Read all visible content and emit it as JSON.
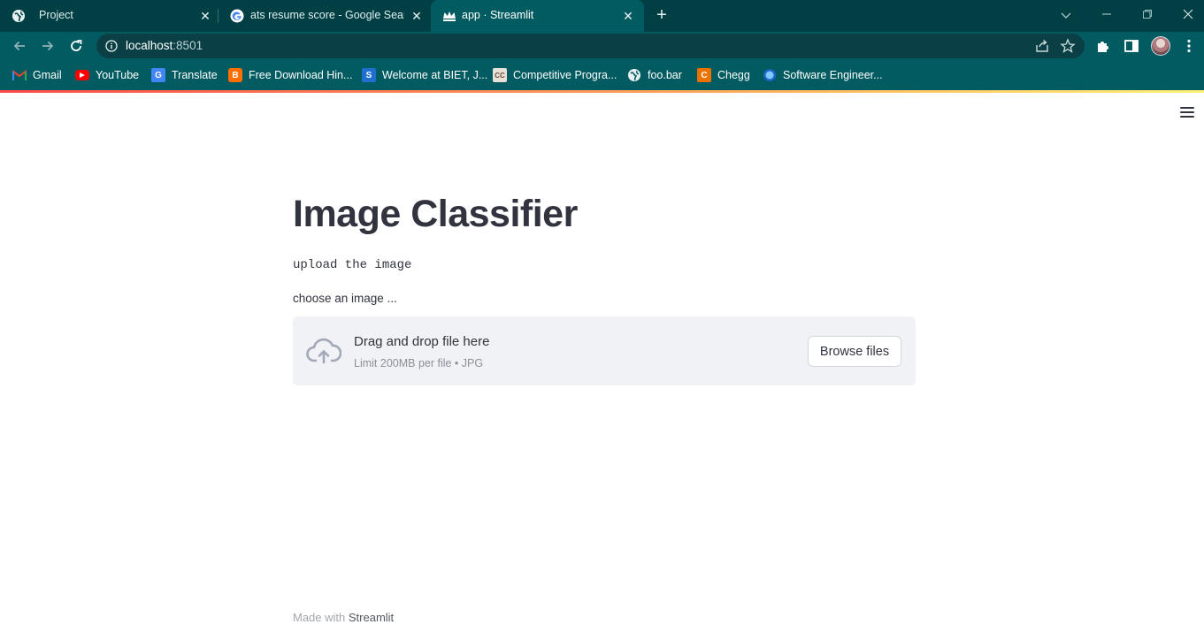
{
  "browser": {
    "tabs": [
      {
        "title": "Project",
        "icon": "globe-icon",
        "active": false
      },
      {
        "title": "ats resume score - Google Search",
        "icon": "google-icon",
        "active": false
      },
      {
        "title": "app · Streamlit",
        "icon": "streamlit-crown-icon",
        "active": true
      }
    ],
    "url_host": "localhost",
    "url_port": ":8501",
    "bookmarks": [
      {
        "label": "Gmail",
        "icon": "gmail-icon",
        "color": "#ea4335"
      },
      {
        "label": "YouTube",
        "icon": "youtube-icon",
        "color": "#ff0000"
      },
      {
        "label": "Translate",
        "icon": "translate-icon",
        "color": "#4285f4"
      },
      {
        "label": "Free Download Hin...",
        "icon": "blogger-icon",
        "color": "#ff6f00"
      },
      {
        "label": "Welcome at BIET, J...",
        "icon": "s-icon",
        "color": "#1f6fd1"
      },
      {
        "label": "Competitive Progra...",
        "icon": "cc-icon",
        "color": "#6b4a3a"
      },
      {
        "label": "foo.bar",
        "icon": "globe-icon",
        "color": "#ffffff"
      },
      {
        "label": "Chegg",
        "icon": "chegg-icon",
        "color": "#eb7100"
      },
      {
        "label": "Software Engineer...",
        "icon": "circle-icon",
        "color": "#3aa0ff"
      }
    ]
  },
  "app": {
    "title": "Image Classifier",
    "subtitle": "upload the image",
    "uploader_label": "choose an image ...",
    "dropzone_title": "Drag and drop file here",
    "dropzone_limit": "Limit 200MB per file • JPG",
    "browse_label": "Browse files",
    "footer_prefix": "Made with ",
    "footer_brand": "Streamlit"
  },
  "colors": {
    "tabbar_bg": "#003f44",
    "toolbar_bg": "#015b61",
    "text_primary": "#31333f",
    "dropzone_bg": "#f0f2f6"
  }
}
